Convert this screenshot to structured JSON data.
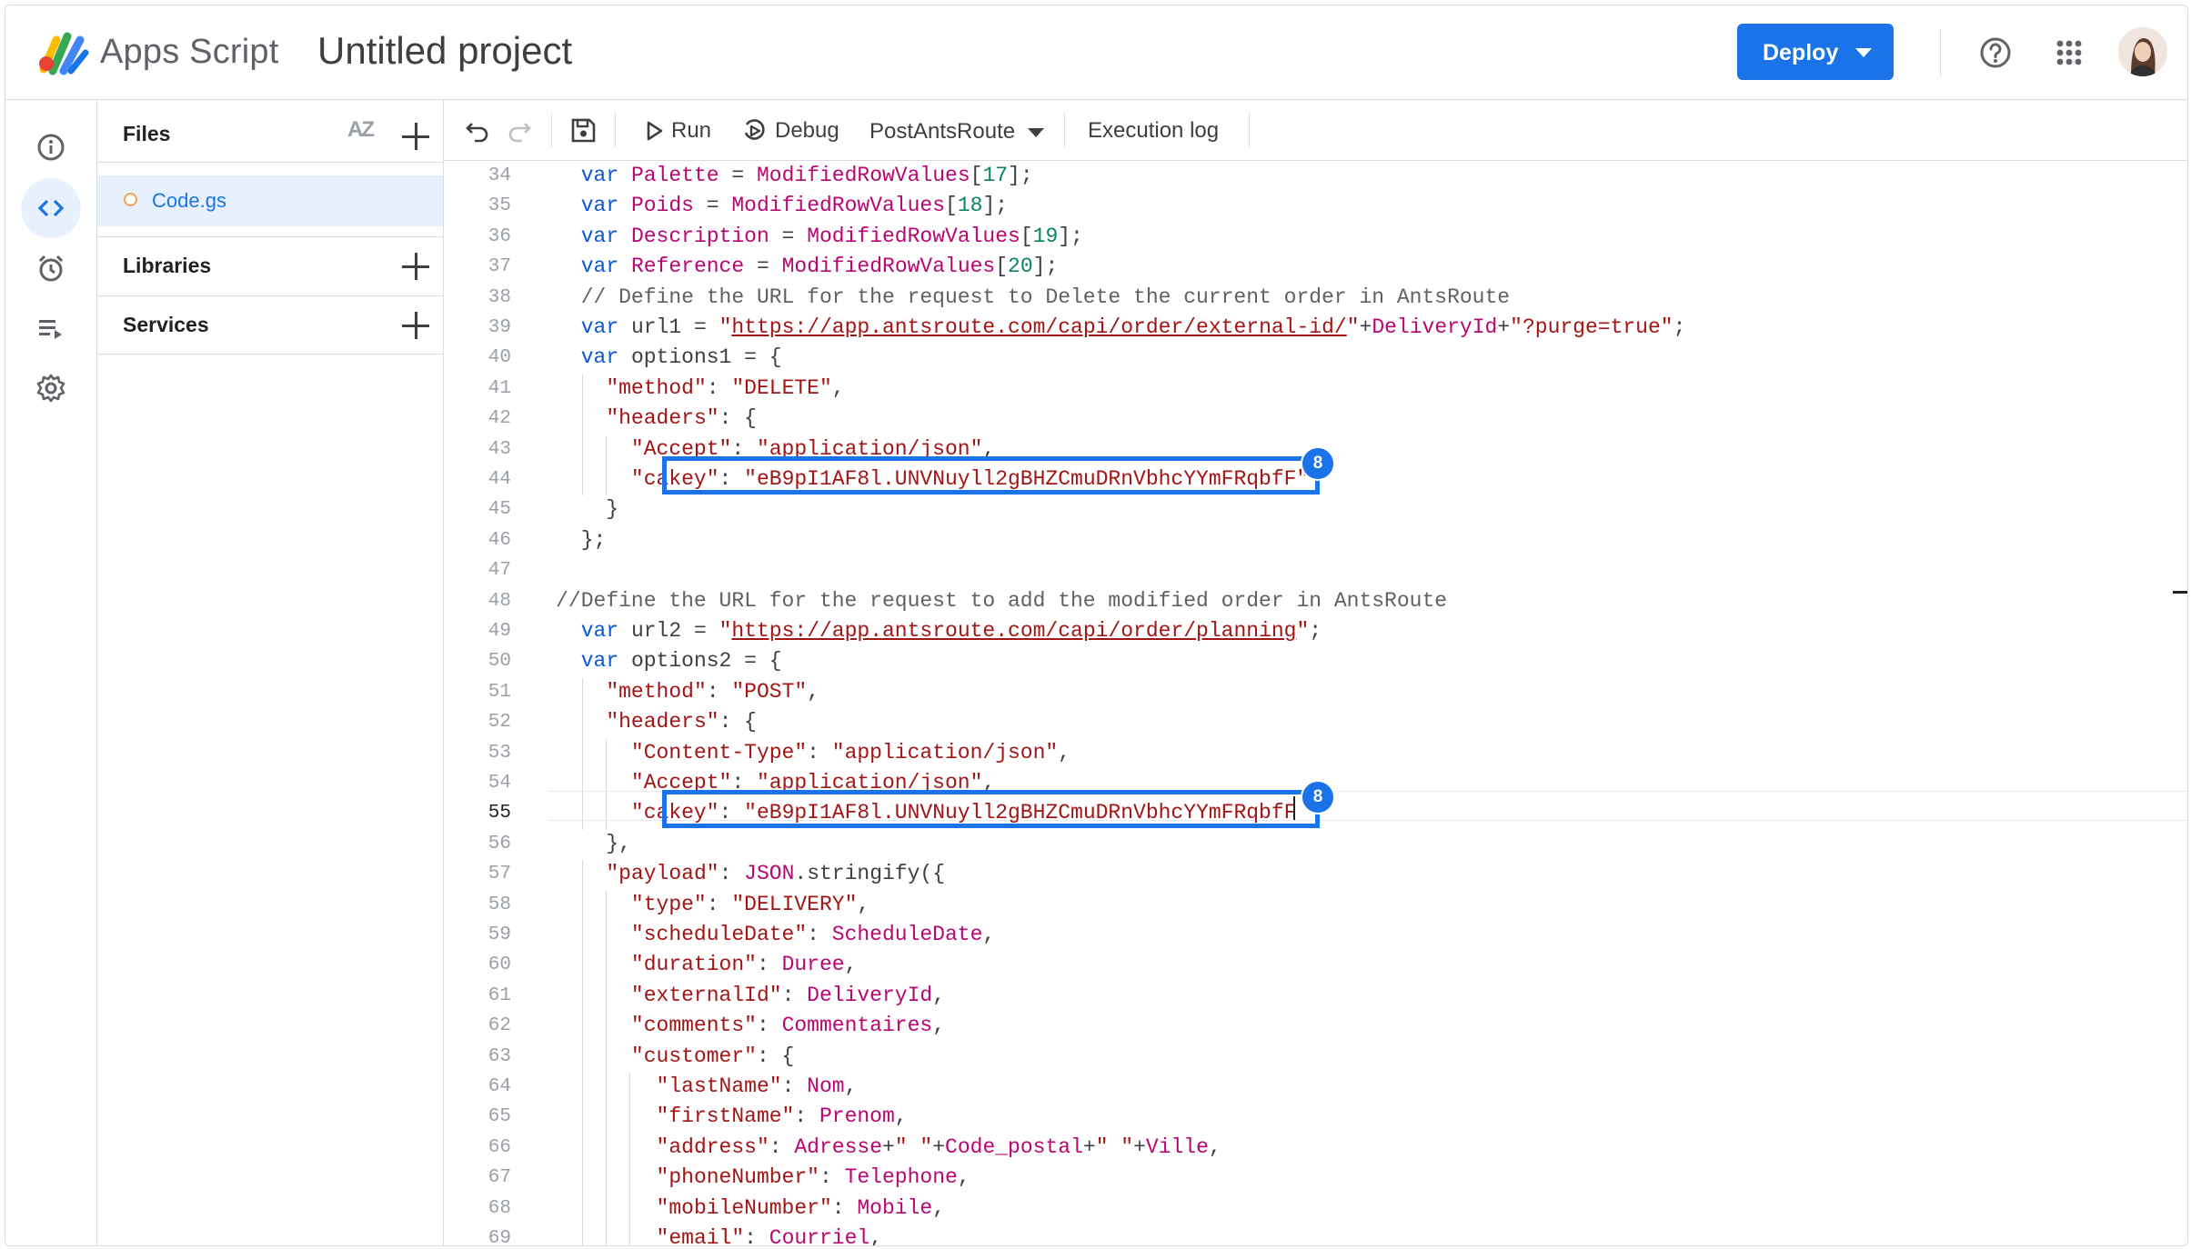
{
  "header": {
    "app_name": "Apps Script",
    "project_title": "Untitled project",
    "deploy_label": "Deploy"
  },
  "files_panel": {
    "title": "Files",
    "sort_label": "AZ",
    "file_name": "Code.gs",
    "libraries_label": "Libraries",
    "services_label": "Services"
  },
  "toolbar": {
    "run_label": "Run",
    "debug_label": "Debug",
    "function_select": "PostAntsRoute",
    "execution_log_label": "Execution log"
  },
  "editor": {
    "line_numbers": [
      "34",
      "35",
      "36",
      "37",
      "38",
      "39",
      "40",
      "41",
      "42",
      "43",
      "44",
      "45",
      "46",
      "47",
      "48",
      "49",
      "50",
      "51",
      "52",
      "53",
      "54",
      "55",
      "56",
      "57",
      "58",
      "59",
      "60",
      "61",
      "62",
      "63",
      "64",
      "65",
      "66",
      "67",
      "68",
      "69"
    ],
    "current_line": "55",
    "badge_label": "8",
    "lines": [
      [
        {
          "t": "    "
        },
        {
          "t": "var ",
          "c": "k"
        },
        {
          "t": "Palette",
          "c": "v"
        },
        {
          "t": " = "
        },
        {
          "t": "ModifiedRowValues",
          "c": "v"
        },
        {
          "t": "["
        },
        {
          "t": "17",
          "c": "n"
        },
        {
          "t": "];"
        }
      ],
      [
        {
          "t": "    "
        },
        {
          "t": "var ",
          "c": "k"
        },
        {
          "t": "Poids",
          "c": "v"
        },
        {
          "t": " = "
        },
        {
          "t": "ModifiedRowValues",
          "c": "v"
        },
        {
          "t": "["
        },
        {
          "t": "18",
          "c": "n"
        },
        {
          "t": "];"
        }
      ],
      [
        {
          "t": "    "
        },
        {
          "t": "var ",
          "c": "k"
        },
        {
          "t": "Description",
          "c": "v"
        },
        {
          "t": " = "
        },
        {
          "t": "ModifiedRowValues",
          "c": "v"
        },
        {
          "t": "["
        },
        {
          "t": "19",
          "c": "n"
        },
        {
          "t": "];"
        }
      ],
      [
        {
          "t": "    "
        },
        {
          "t": "var ",
          "c": "k"
        },
        {
          "t": "Reference",
          "c": "v"
        },
        {
          "t": " = "
        },
        {
          "t": "ModifiedRowValues",
          "c": "v"
        },
        {
          "t": "["
        },
        {
          "t": "20",
          "c": "n"
        },
        {
          "t": "];"
        }
      ],
      [
        {
          "t": "    "
        },
        {
          "t": "// Define the URL for the request to Delete the current order in AntsRoute",
          "c": "c"
        }
      ],
      [
        {
          "t": "    "
        },
        {
          "t": "var ",
          "c": "k"
        },
        {
          "t": "url1 = "
        },
        {
          "t": "\"",
          "c": "s"
        },
        {
          "t": "https://app.antsroute.com/capi/order/external-id/",
          "c": "u"
        },
        {
          "t": "\"",
          "c": "s"
        },
        {
          "t": "+"
        },
        {
          "t": "DeliveryId",
          "c": "v"
        },
        {
          "t": "+"
        },
        {
          "t": "\"?purge=true\"",
          "c": "s"
        },
        {
          "t": ";"
        }
      ],
      [
        {
          "t": "    "
        },
        {
          "t": "var ",
          "c": "k"
        },
        {
          "t": "options1 = {"
        }
      ],
      [
        {
          "t": "      "
        },
        {
          "t": "\"method\"",
          "c": "s"
        },
        {
          "t": ": "
        },
        {
          "t": "\"DELETE\"",
          "c": "s"
        },
        {
          "t": ","
        }
      ],
      [
        {
          "t": "      "
        },
        {
          "t": "\"headers\"",
          "c": "s"
        },
        {
          "t": ": {"
        }
      ],
      [
        {
          "t": "        "
        },
        {
          "t": "\"Accept\"",
          "c": "s"
        },
        {
          "t": ": "
        },
        {
          "t": "\"application/json\"",
          "c": "s"
        },
        {
          "t": ","
        }
      ],
      [
        {
          "t": "        "
        },
        {
          "t": "\"cakey\"",
          "c": "s"
        },
        {
          "t": ": "
        },
        {
          "t": "\"eB9pI1AF8l.UNVNuyll2gBHZCmuDRnVbhcYYmFRqbfF\"",
          "c": "s"
        }
      ],
      [
        {
          "t": "      }"
        }
      ],
      [
        {
          "t": "    };"
        }
      ],
      [
        {
          "t": ""
        }
      ],
      [
        {
          "t": "  "
        },
        {
          "t": "//Define the URL for the request to add the modified order in AntsRoute",
          "c": "c"
        }
      ],
      [
        {
          "t": "    "
        },
        {
          "t": "var ",
          "c": "k"
        },
        {
          "t": "url2 = "
        },
        {
          "t": "\"",
          "c": "s"
        },
        {
          "t": "https://app.antsroute.com/capi/order/planning",
          "c": "u"
        },
        {
          "t": "\"",
          "c": "s"
        },
        {
          "t": ";"
        }
      ],
      [
        {
          "t": "    "
        },
        {
          "t": "var ",
          "c": "k"
        },
        {
          "t": "options2 = {"
        }
      ],
      [
        {
          "t": "      "
        },
        {
          "t": "\"method\"",
          "c": "s"
        },
        {
          "t": ": "
        },
        {
          "t": "\"POST\"",
          "c": "s"
        },
        {
          "t": ","
        }
      ],
      [
        {
          "t": "      "
        },
        {
          "t": "\"headers\"",
          "c": "s"
        },
        {
          "t": ": {"
        }
      ],
      [
        {
          "t": "        "
        },
        {
          "t": "\"Content-Type\"",
          "c": "s"
        },
        {
          "t": ": "
        },
        {
          "t": "\"application/json\"",
          "c": "s"
        },
        {
          "t": ","
        }
      ],
      [
        {
          "t": "        "
        },
        {
          "t": "\"Accept\"",
          "c": "s"
        },
        {
          "t": ": "
        },
        {
          "t": "\"application/json\"",
          "c": "s"
        },
        {
          "t": ","
        }
      ],
      [
        {
          "t": "        "
        },
        {
          "t": "\"cakey\"",
          "c": "s"
        },
        {
          "t": ": "
        },
        {
          "t": "\"eB9pI1AF8l.UNVNuyll2gBHZCmuDRnVbhcYYmFRqbfF",
          "c": "s"
        }
      ],
      [
        {
          "t": "      },"
        }
      ],
      [
        {
          "t": "      "
        },
        {
          "t": "\"payload\"",
          "c": "s"
        },
        {
          "t": ": "
        },
        {
          "t": "JSON",
          "c": "v"
        },
        {
          "t": ".stringify({"
        }
      ],
      [
        {
          "t": "        "
        },
        {
          "t": "\"type\"",
          "c": "s"
        },
        {
          "t": ": "
        },
        {
          "t": "\"DELIVERY\"",
          "c": "s"
        },
        {
          "t": ","
        }
      ],
      [
        {
          "t": "        "
        },
        {
          "t": "\"scheduleDate\"",
          "c": "s"
        },
        {
          "t": ": "
        },
        {
          "t": "ScheduleDate",
          "c": "v"
        },
        {
          "t": ","
        }
      ],
      [
        {
          "t": "        "
        },
        {
          "t": "\"duration\"",
          "c": "s"
        },
        {
          "t": ": "
        },
        {
          "t": "Duree",
          "c": "v"
        },
        {
          "t": ","
        }
      ],
      [
        {
          "t": "        "
        },
        {
          "t": "\"externalId\"",
          "c": "s"
        },
        {
          "t": ": "
        },
        {
          "t": "DeliveryId",
          "c": "v"
        },
        {
          "t": ","
        }
      ],
      [
        {
          "t": "        "
        },
        {
          "t": "\"comments\"",
          "c": "s"
        },
        {
          "t": ": "
        },
        {
          "t": "Commentaires",
          "c": "v"
        },
        {
          "t": ","
        }
      ],
      [
        {
          "t": "        "
        },
        {
          "t": "\"customer\"",
          "c": "s"
        },
        {
          "t": ": {"
        }
      ],
      [
        {
          "t": "          "
        },
        {
          "t": "\"lastName\"",
          "c": "s"
        },
        {
          "t": ": "
        },
        {
          "t": "Nom",
          "c": "v"
        },
        {
          "t": ","
        }
      ],
      [
        {
          "t": "          "
        },
        {
          "t": "\"firstName\"",
          "c": "s"
        },
        {
          "t": ": "
        },
        {
          "t": "Prenom",
          "c": "v"
        },
        {
          "t": ","
        }
      ],
      [
        {
          "t": "          "
        },
        {
          "t": "\"address\"",
          "c": "s"
        },
        {
          "t": ": "
        },
        {
          "t": "Adresse",
          "c": "v"
        },
        {
          "t": "+"
        },
        {
          "t": "\" \"",
          "c": "s"
        },
        {
          "t": "+"
        },
        {
          "t": "Code_postal",
          "c": "v"
        },
        {
          "t": "+"
        },
        {
          "t": "\" \"",
          "c": "s"
        },
        {
          "t": "+"
        },
        {
          "t": "Ville",
          "c": "v"
        },
        {
          "t": ","
        }
      ],
      [
        {
          "t": "          "
        },
        {
          "t": "\"phoneNumber\"",
          "c": "s"
        },
        {
          "t": ": "
        },
        {
          "t": "Telephone",
          "c": "v"
        },
        {
          "t": ","
        }
      ],
      [
        {
          "t": "          "
        },
        {
          "t": "\"mobileNumber\"",
          "c": "s"
        },
        {
          "t": ": "
        },
        {
          "t": "Mobile",
          "c": "v"
        },
        {
          "t": ","
        }
      ],
      [
        {
          "t": "          "
        },
        {
          "t": "\"email\"",
          "c": "s"
        },
        {
          "t": ": "
        },
        {
          "t": "Courriel",
          "c": "v"
        },
        {
          "t": ","
        }
      ]
    ]
  },
  "icons": {
    "rail": [
      "info-icon",
      "code-icon",
      "alarm-clock-icon",
      "executions-icon",
      "settings-gear-icon"
    ],
    "header": [
      "help-icon",
      "apps-grid-icon"
    ]
  },
  "colors": {
    "accent": "#1a73e8",
    "keyword": "#0b57d0",
    "identifier": "#b80672",
    "string": "#a31515",
    "number": "#098658"
  }
}
